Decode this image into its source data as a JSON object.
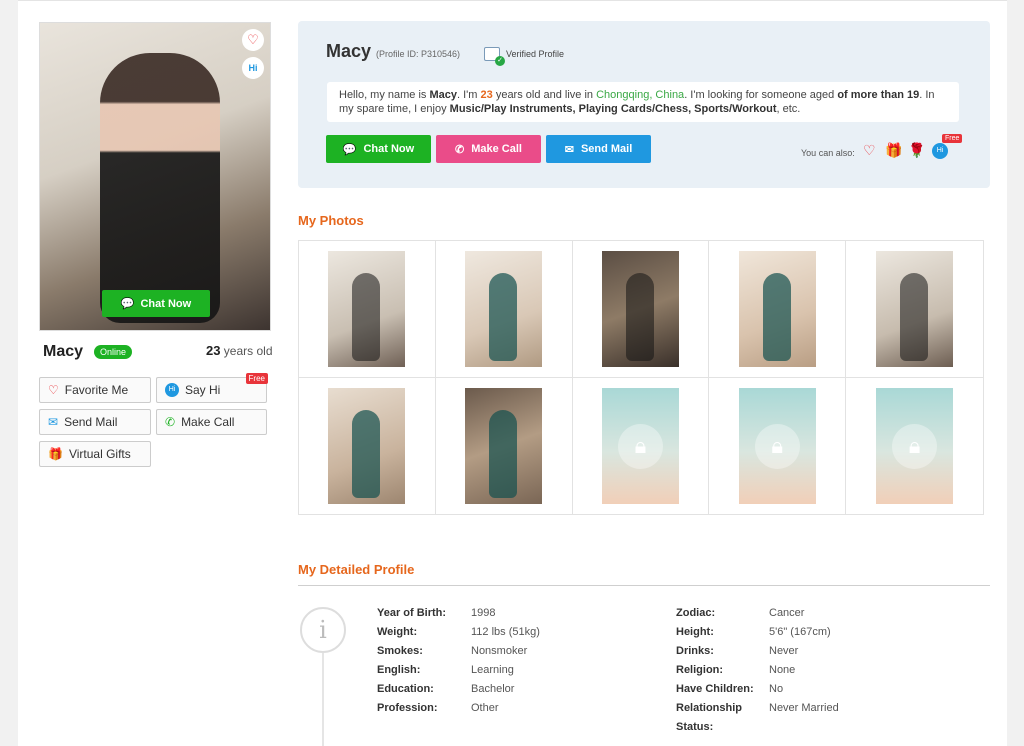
{
  "sidebar": {
    "name": "Macy",
    "status": "Online",
    "age_number": "23",
    "age_suffix": " years old",
    "photo_button": "Chat Now",
    "buttons": {
      "favorite": "Favorite Me",
      "say_hi": "Say Hi",
      "say_hi_tag": "Free",
      "send_mail": "Send Mail",
      "make_call": "Make Call",
      "virtual_gifts": "Virtual Gifts"
    },
    "photo_hi_badge": "Hi"
  },
  "profile": {
    "name": "Macy",
    "id_text": "(Profile ID: P310546)",
    "verified": "Verified Profile",
    "bio": {
      "p1": "Hello, my name is ",
      "name": "Macy",
      "p2": ". I'm ",
      "age": "23",
      "p3": " years old and live in ",
      "location": "Chongqing, China",
      "p4": ". I'm looking for someone aged ",
      "seek": "of more than 19",
      "p5": ". In my spare time, I enjoy ",
      "hobbies": "Music/Play Instruments, Playing Cards/Chess, Sports/Workout",
      "p6": ", etc."
    },
    "actions": {
      "chat": "Chat Now",
      "call": "Make Call",
      "mail": "Send Mail"
    },
    "also_label": "You can also:",
    "also_free": "Free",
    "also_hi": "Hi"
  },
  "photos_section": {
    "title": "My Photos",
    "photos": [
      {
        "locked": false
      },
      {
        "locked": false
      },
      {
        "locked": false
      },
      {
        "locked": false
      },
      {
        "locked": false
      },
      {
        "locked": false
      },
      {
        "locked": false
      },
      {
        "locked": true
      },
      {
        "locked": true
      },
      {
        "locked": true
      }
    ]
  },
  "details": {
    "title": "My Detailed Profile",
    "left": [
      {
        "label": "Year of Birth:",
        "value": "1998"
      },
      {
        "label": "Weight:",
        "value": "112 lbs (51kg)"
      },
      {
        "label": "Smokes:",
        "value": "Nonsmoker"
      },
      {
        "label": "English:",
        "value": "Learning"
      },
      {
        "label": "Education:",
        "value": "Bachelor"
      },
      {
        "label": "Profession:",
        "value": "Other"
      }
    ],
    "right": [
      {
        "label": "Zodiac:",
        "value": "Cancer"
      },
      {
        "label": "Height:",
        "value": "5'6\" (167cm)"
      },
      {
        "label": "Drinks:",
        "value": "Never"
      },
      {
        "label": "Religion:",
        "value": "None"
      },
      {
        "label": "Have Children:",
        "value": "No"
      },
      {
        "label": "Relationship",
        "label2": "Status:",
        "value": "Never Married"
      }
    ]
  },
  "colors": {
    "accent_orange": "#e6671d",
    "green": "#1db223",
    "pink": "#ea4c89",
    "blue": "#1f98e0"
  }
}
